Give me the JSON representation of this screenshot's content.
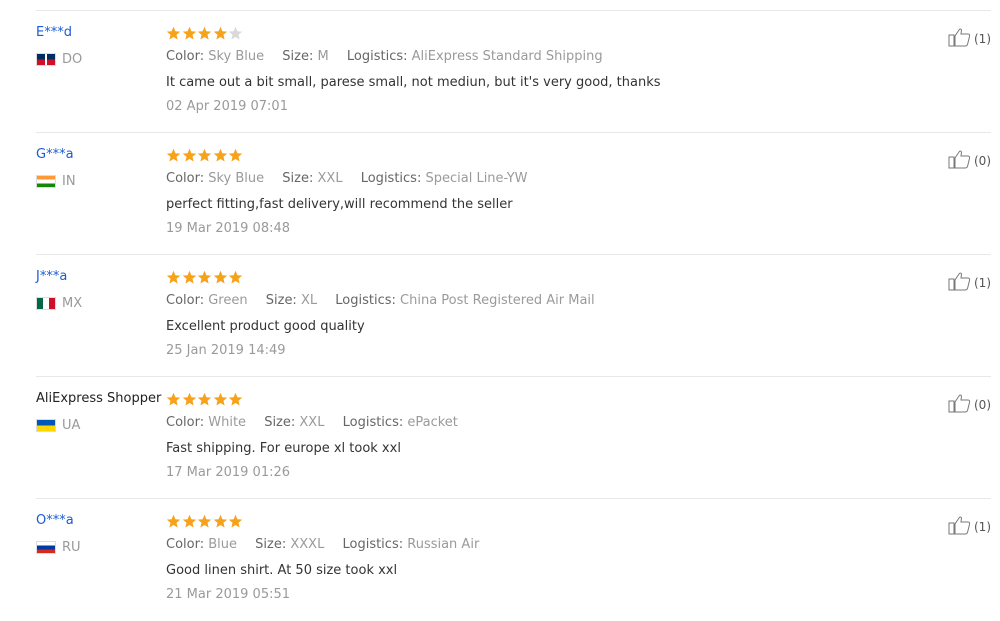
{
  "reviews": [
    {
      "user": "E***d",
      "country": "DO",
      "flag": "do",
      "rating": 4,
      "color_label": "Color:",
      "color": "Sky Blue",
      "size_label": "Size:",
      "size": "M",
      "logistics_label": "Logistics:",
      "logistics": "AliExpress Standard Shipping",
      "comment": "It came out a bit small, parese small, not mediun, but it's very good, thanks",
      "date": "02 Apr 2019 07:01",
      "helpful": "(1)"
    },
    {
      "user": "G***a",
      "country": "IN",
      "flag": "in",
      "rating": 5,
      "color_label": "Color:",
      "color": "Sky Blue",
      "size_label": "Size:",
      "size": "XXL",
      "logistics_label": "Logistics:",
      "logistics": "Special Line-YW",
      "comment": "perfect fitting,fast delivery,will recommend the seller",
      "date": "19 Mar 2019 08:48",
      "helpful": "(0)"
    },
    {
      "user": "J***a",
      "country": "MX",
      "flag": "mx",
      "rating": 5,
      "color_label": "Color:",
      "color": "Green",
      "size_label": "Size:",
      "size": "XL",
      "logistics_label": "Logistics:",
      "logistics": "China Post Registered Air Mail",
      "comment": "Excellent product good quality",
      "date": "25 Jan 2019 14:49",
      "helpful": "(1)"
    },
    {
      "user": "AliExpress Shopper",
      "country": "UA",
      "flag": "ua",
      "rating": 5,
      "color_label": "Color:",
      "color": "White",
      "size_label": "Size:",
      "size": "XXL",
      "logistics_label": "Logistics:",
      "logistics": "ePacket",
      "comment": "Fast shipping. For europe xl took xxl",
      "date": "17 Mar 2019 01:26",
      "helpful": "(0)"
    },
    {
      "user": "O***a",
      "country": "RU",
      "flag": "ru",
      "rating": 5,
      "color_label": "Color:",
      "color": "Blue",
      "size_label": "Size:",
      "size": "XXXL",
      "logistics_label": "Logistics:",
      "logistics": "Russian Air",
      "comment": "Good linen shirt. At 50 size took xxl",
      "date": "21 Mar 2019 05:51",
      "helpful": "(1)"
    }
  ],
  "colors": {
    "star_filled": "#f7a21b",
    "star_empty": "#d9d9d9",
    "user_link": "#1a5bd6"
  },
  "icons": {
    "helpful": "thumbs-up-icon",
    "rating": "star-icon"
  }
}
